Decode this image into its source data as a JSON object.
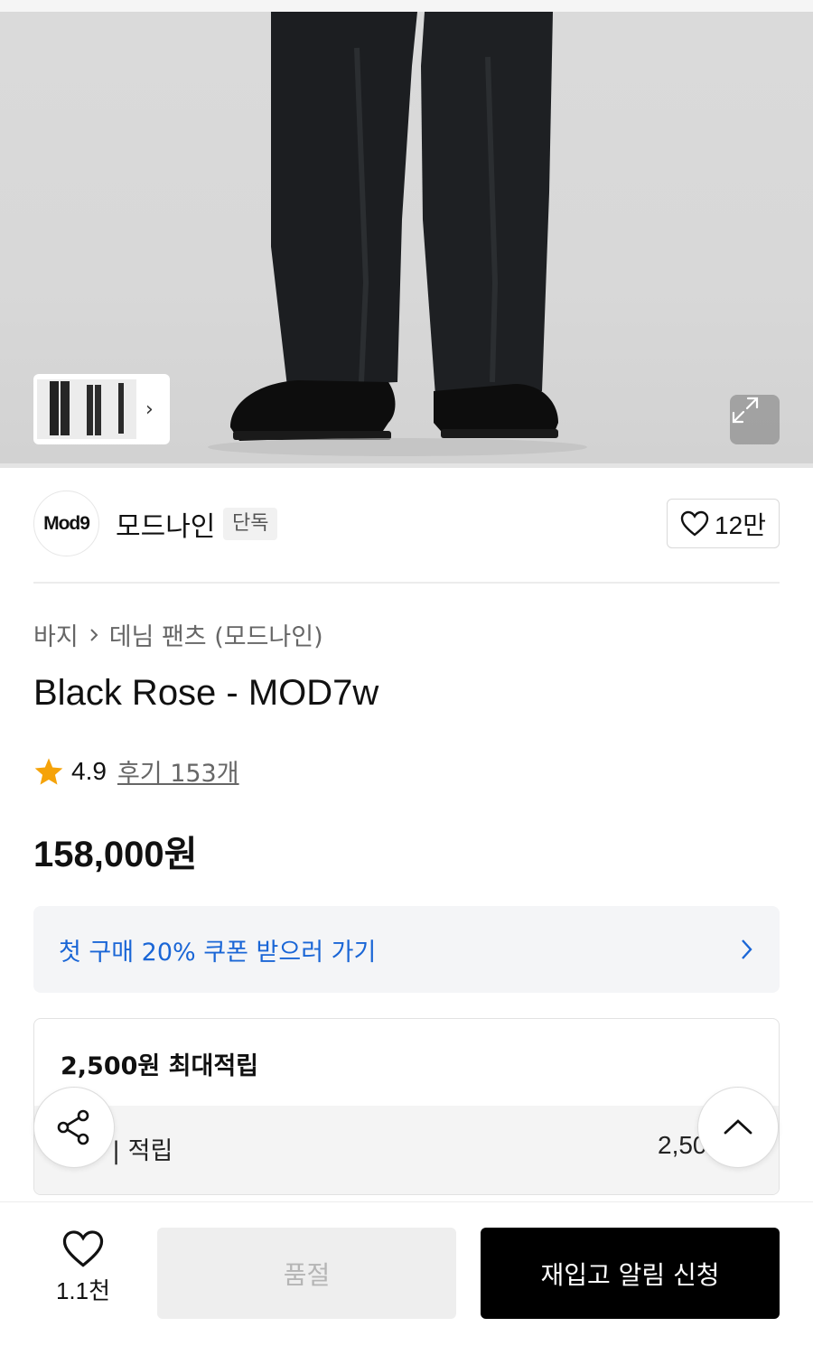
{
  "gallery": {
    "expand_icon": "expand-arrows-icon",
    "thumbnail_icon": "chevron-right-icon"
  },
  "brand": {
    "logo_text": "Mod9",
    "name": "모드나인",
    "badge": "단독",
    "like_count": "12만",
    "like_icon": "heart-outline-icon"
  },
  "product": {
    "breadcrumb": [
      "바지",
      "데님 팬츠 (모드나인)"
    ],
    "title": "Black Rose - MOD7w",
    "rating": "4.9",
    "review_link": "후기 153개",
    "price": "158,000원"
  },
  "coupon": {
    "text": "첫 구매 20% 쿠폰 받으러 가기",
    "accent_color": "#1a66d6"
  },
  "points": {
    "title": "2,500원 최대적립",
    "row_label": "| 적립",
    "row_value": "2,50"
  },
  "bottom_bar": {
    "wish_count": "1.1천",
    "soldout_label": "품절",
    "restock_label": "재입고 알림 신청"
  }
}
